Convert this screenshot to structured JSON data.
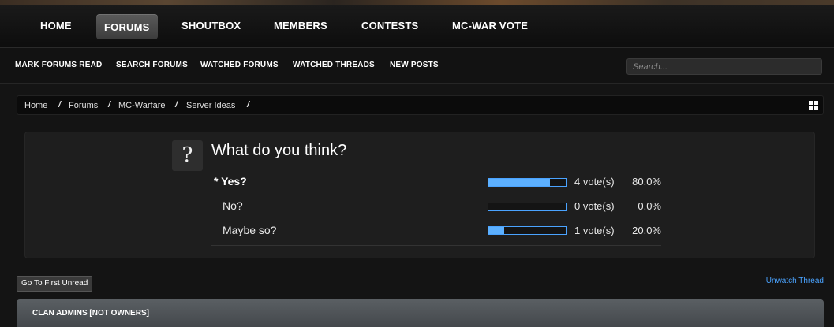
{
  "nav": {
    "items": [
      {
        "label": "HOME"
      },
      {
        "label": "FORUMS",
        "active": true
      },
      {
        "label": "SHOUTBOX"
      },
      {
        "label": "MEMBERS"
      },
      {
        "label": "CONTESTS"
      },
      {
        "label": "MC-WAR VOTE"
      }
    ]
  },
  "subnav": {
    "items": [
      {
        "label": "MARK FORUMS READ"
      },
      {
        "label": "SEARCH FORUMS"
      },
      {
        "label": "WATCHED FORUMS"
      },
      {
        "label": "WATCHED THREADS"
      },
      {
        "label": "NEW POSTS"
      }
    ],
    "search_placeholder": "Search..."
  },
  "breadcrumb": {
    "items": [
      "Home",
      "Forums",
      "MC-Warfare",
      "Server Ideas"
    ],
    "separator": "/"
  },
  "poll": {
    "icon": "?",
    "question": "What do you think?",
    "options": [
      {
        "label": "* Yes?",
        "votes": "4 vote(s)",
        "percent": "80.0%",
        "fraction": 0.8,
        "chosen": true
      },
      {
        "label": "No?",
        "votes": "0 vote(s)",
        "percent": "0.0%",
        "fraction": 0.0,
        "chosen": false
      },
      {
        "label": "Maybe so?",
        "votes": "1 vote(s)",
        "percent": "20.0%",
        "fraction": 0.2,
        "chosen": false
      }
    ]
  },
  "actions": {
    "first_unread": "Go To First Unread",
    "unwatch": "Unwatch Thread"
  },
  "thread": {
    "title": "CLAN ADMINS [NOT OWNERS]"
  },
  "colors": {
    "accent": "#4aa3ff",
    "bar_fill": "#5cb0ff",
    "background": "#141414"
  }
}
